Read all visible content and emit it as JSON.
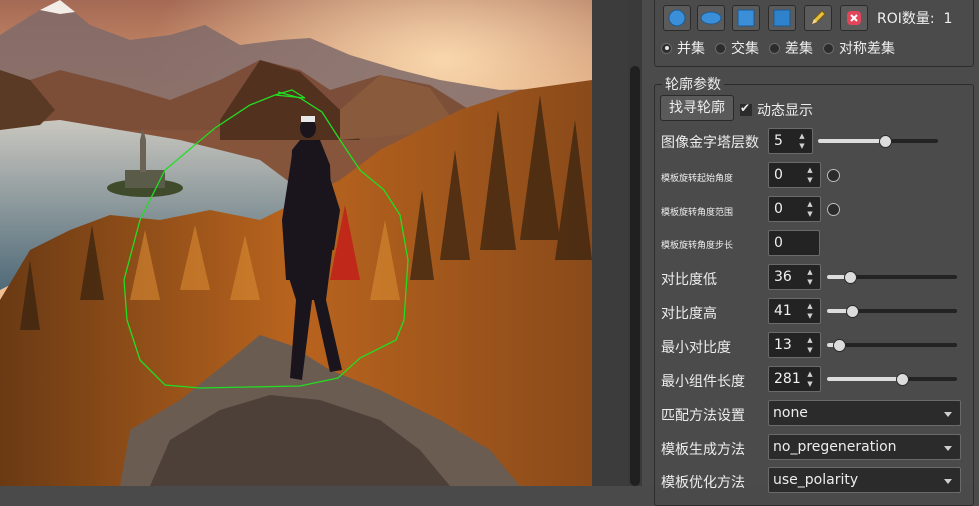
{
  "toolbar": {
    "buttons": [
      {
        "icon": "circle-icon"
      },
      {
        "icon": "ellipse-icon"
      },
      {
        "icon": "rectangle-icon"
      },
      {
        "icon": "rotated-rectangle-icon"
      },
      {
        "icon": "pencil-icon"
      },
      {
        "icon": "clear-roi-icon"
      }
    ],
    "roi_count_label": "ROI数量:",
    "roi_count_value": "1"
  },
  "region_ops": {
    "options": [
      "并集",
      "交集",
      "差集",
      "对称差集"
    ],
    "selected": "并集"
  },
  "contour_params": {
    "title": "轮廓参数",
    "find_button": "找寻轮廓",
    "dynamic_display_label": "动态显示",
    "dynamic_display_checked": true,
    "rows": [
      {
        "label": "图像金字塔层数",
        "value": "5",
        "slider_fraction": 0.56
      },
      {
        "label": "模板旋转起始角度",
        "value": "0",
        "slider_fraction": 0.0
      },
      {
        "label": "模板旋转角度范围",
        "value": "0",
        "slider_fraction": 0.0
      },
      {
        "label": "模板旋转角度步长",
        "value": "0"
      },
      {
        "label": "对比度低",
        "value": "36",
        "slider_fraction": 0.14
      },
      {
        "label": "对比度高",
        "value": "41",
        "slider_fraction": 0.16
      },
      {
        "label": "最小对比度",
        "value": "13",
        "slider_fraction": 0.05
      },
      {
        "label": "最小组件长度",
        "value": "281",
        "slider_fraction": 0.58
      }
    ],
    "combos": [
      {
        "label": "匹配方法设置",
        "value": "none"
      },
      {
        "label": "模板生成方法",
        "value": "no_pregeneration"
      },
      {
        "label": "模板优化方法",
        "value": "use_polarity"
      }
    ]
  },
  "colors": {
    "roi_outline": "#22dd22",
    "panel_bg": "#4b4b4b"
  }
}
